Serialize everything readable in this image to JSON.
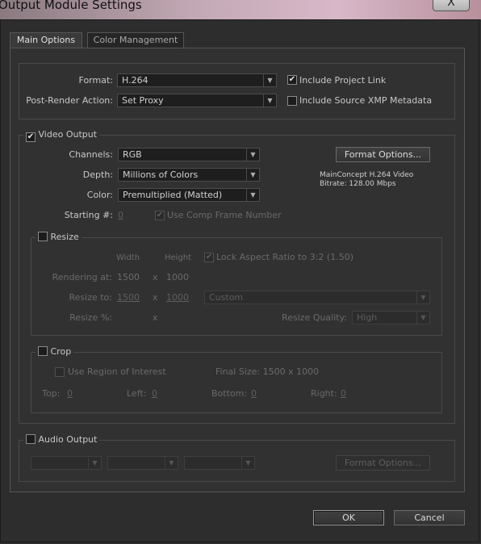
{
  "window": {
    "title": "Output Module Settings",
    "close_label": "X"
  },
  "tabs": [
    {
      "label": "Main Options"
    },
    {
      "label": "Color Management"
    }
  ],
  "top": {
    "format_label": "Format:",
    "format_value": "H.264",
    "post_render_label": "Post-Render Action:",
    "post_render_value": "Set Proxy",
    "include_project_link": "Include Project Link",
    "include_project_link_checked": true,
    "include_xmp": "Include Source XMP Metadata",
    "include_xmp_checked": false
  },
  "video": {
    "title": "Video Output",
    "checked": true,
    "channels_label": "Channels:",
    "channels_value": "RGB",
    "depth_label": "Depth:",
    "depth_value": "Millions of Colors",
    "color_label": "Color:",
    "color_value": "Premultiplied (Matted)",
    "format_options": "Format Options...",
    "codec_info": "MainConcept H.264 Video",
    "bitrate_info": "Bitrate: 128.00 Mbps",
    "starting_label": "Starting #:",
    "starting_value": "0",
    "use_comp_frame": "Use Comp Frame Number"
  },
  "resize": {
    "title": "Resize",
    "width_header": "Width",
    "height_header": "Height",
    "lock_aspect": "Lock Aspect Ratio to 3:2 (1.50)",
    "rendering_label": "Rendering at:",
    "rendering_w": "1500",
    "rendering_h": "1000",
    "resize_to_label": "Resize to:",
    "resize_w": "1500",
    "resize_h": "1000",
    "preset": "Custom",
    "resize_pct_label": "Resize %:",
    "x": "x",
    "quality_label": "Resize Quality:",
    "quality_value": "High"
  },
  "crop": {
    "title": "Crop",
    "use_roi": "Use Region of Interest",
    "final_size": "Final Size: 1500 x 1000",
    "top_label": "Top:",
    "top_value": "0",
    "left_label": "Left:",
    "left_value": "0",
    "bottom_label": "Bottom:",
    "bottom_value": "0",
    "right_label": "Right:",
    "right_value": "0"
  },
  "audio": {
    "title": "Audio Output",
    "checked": false,
    "format_options": "Format Options..."
  },
  "footer": {
    "ok": "OK",
    "cancel": "Cancel"
  },
  "icons": {
    "dropdown": "▼",
    "check": "✔"
  },
  "colors": {
    "background": "#2e2e2e",
    "panel": "#313131",
    "field": "#1e1e1e",
    "text": "#c8c8c8",
    "disabled": "#6a6a6a"
  }
}
